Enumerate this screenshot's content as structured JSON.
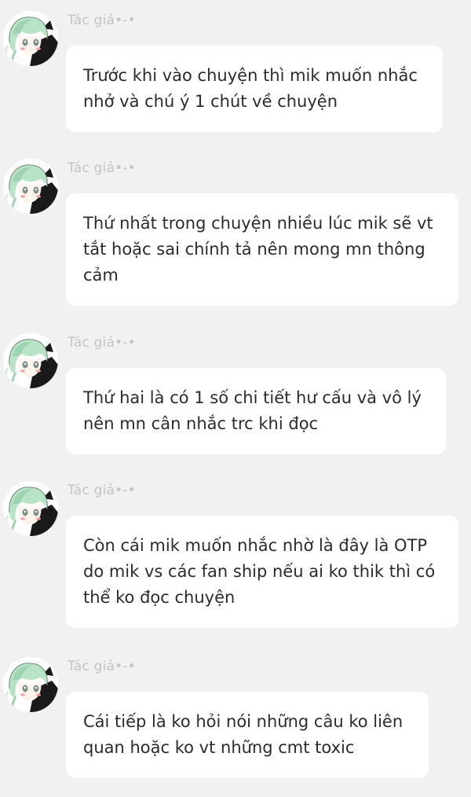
{
  "messages": [
    {
      "author": "Tác giả•-•",
      "text": "Trước khi vào chuyện thì mik muốn nhắc\nnhở và chú ý 1 chút về chuyện"
    },
    {
      "author": "Tác giả•-•",
      "text": "Thứ nhất trong chuyện nhiều lúc mik sẽ vt\ntắt hoặc sai chính tả nên mong mn thông\ncảm"
    },
    {
      "author": "Tác giả•-•",
      "text": "Thứ hai là có 1 số chi tiết hư cấu và vô lý\nnên mn cân nhắc trc khi đọc"
    },
    {
      "author": "Tác giả•-•",
      "text": "Còn cái mik muốn nhắc nhờ là đây là OTP\ndo mik vs các fan ship nếu ai ko thik thì có\nthể ko đọc chuyện"
    },
    {
      "author": "Tác giả•-•",
      "text": "Cái tiếp là ko hỏi nói những câu ko liên\nquan hoặc ko vt những cmt toxic"
    }
  ],
  "avatar_icon": "anime-character-avatar",
  "colors": {
    "background": "#f1f1f1",
    "bubble": "#ffffff",
    "author_text": "#c4c4c4",
    "message_text": "#2b2b2b"
  }
}
